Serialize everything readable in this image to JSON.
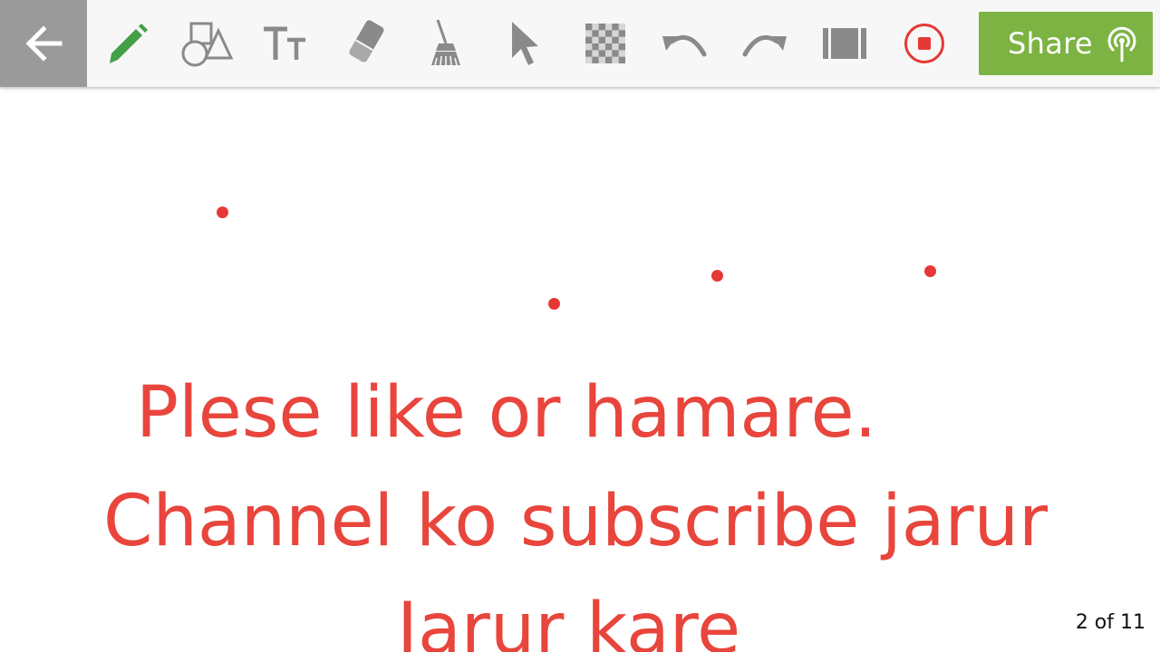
{
  "toolbar": {
    "back": {
      "icon": "arrow-left-icon"
    },
    "tools": [
      {
        "name": "pen",
        "icon": "pencil-icon",
        "color": "#43a047"
      },
      {
        "name": "shapes",
        "icon": "shapes-icon"
      },
      {
        "name": "text",
        "icon": "text-size-icon"
      },
      {
        "name": "eraser",
        "icon": "eraser-icon"
      },
      {
        "name": "clear",
        "icon": "broom-icon"
      },
      {
        "name": "select",
        "icon": "cursor-arrow-icon"
      },
      {
        "name": "background",
        "icon": "checkerboard-icon"
      },
      {
        "name": "undo",
        "icon": "undo-icon"
      },
      {
        "name": "redo",
        "icon": "redo-icon"
      },
      {
        "name": "pages",
        "icon": "filmstrip-icon"
      },
      {
        "name": "record",
        "icon": "record-icon",
        "color": "#e53935"
      }
    ],
    "share": {
      "label": "Share",
      "icon": "broadcast-icon",
      "color": "#7cb342"
    }
  },
  "canvas": {
    "ink_color": "#e8453c",
    "lines": [
      "Plese like or hamare.",
      "Channel ko subscribe jarur",
      "Jarur kare"
    ]
  },
  "pagination": {
    "label": "2 of 11",
    "current": 2,
    "total": 11
  }
}
